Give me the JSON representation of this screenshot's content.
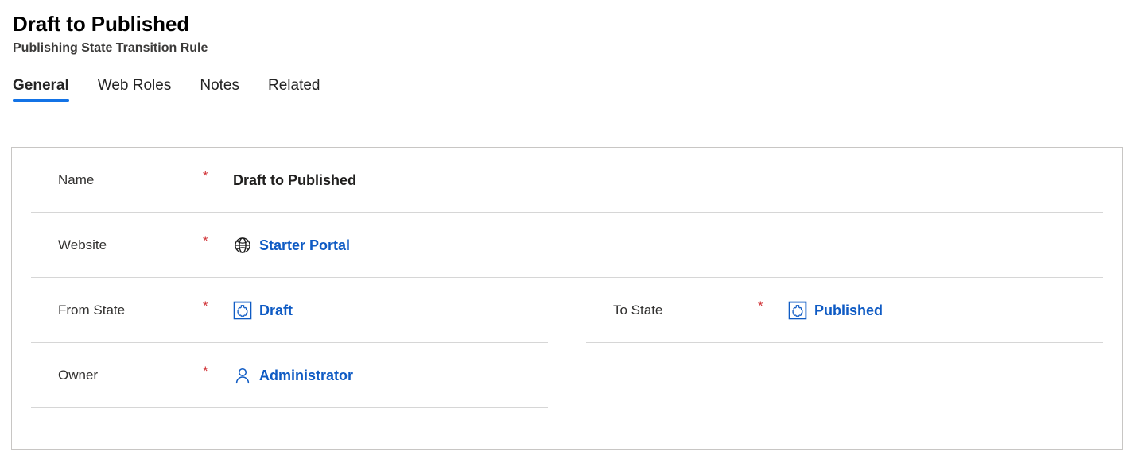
{
  "header": {
    "title": "Draft to Published",
    "subtitle": "Publishing State Transition Rule"
  },
  "tabs": [
    {
      "label": "General",
      "selected": true
    },
    {
      "label": "Web Roles",
      "selected": false
    },
    {
      "label": "Notes",
      "selected": false
    },
    {
      "label": "Related",
      "selected": false
    }
  ],
  "form": {
    "required_marker": "*",
    "rows": [
      {
        "fields": [
          {
            "label": "Name",
            "required": true,
            "value": "Draft to Published",
            "value_kind": "text",
            "icon": null,
            "width": "full"
          }
        ]
      },
      {
        "fields": [
          {
            "label": "Website",
            "required": true,
            "value": "Starter Portal",
            "value_kind": "link",
            "icon": "globe-icon",
            "width": "full"
          }
        ]
      },
      {
        "fields": [
          {
            "label": "From State",
            "required": true,
            "value": "Draft",
            "value_kind": "link",
            "icon": "entity-record-icon",
            "width": "half"
          },
          {
            "label": "To State",
            "required": true,
            "value": "Published",
            "value_kind": "link",
            "icon": "entity-record-icon",
            "width": "half"
          }
        ]
      },
      {
        "fields": [
          {
            "label": "Owner",
            "required": true,
            "value": "Administrator",
            "value_kind": "link",
            "icon": "person-icon",
            "width": "half"
          }
        ]
      }
    ]
  },
  "colors": {
    "link": "#0f5bc4",
    "required": "#d13438",
    "tab_accent": "#1373e6",
    "card_border": "#c8c6c4",
    "row_divider": "#d6d6d6",
    "title": "#000000",
    "subtitle": "#3b3a39"
  }
}
